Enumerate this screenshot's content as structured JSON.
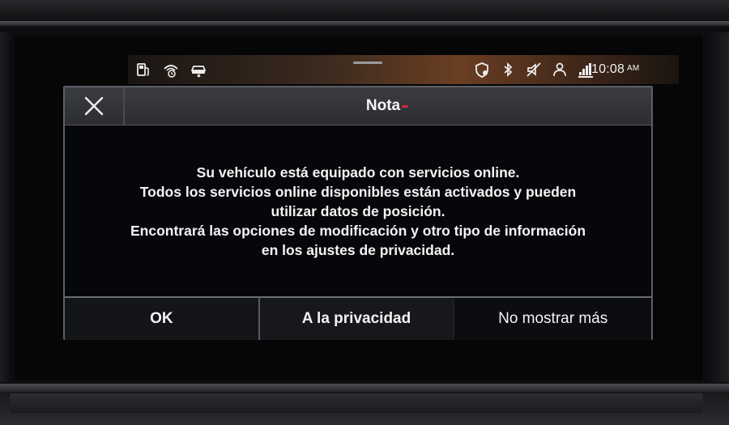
{
  "status_bar": {
    "time": "10:08",
    "ampm": "AM",
    "left_icons": [
      "fuel-icon",
      "connected-services-icon",
      "car-service-icon"
    ],
    "right_icons": [
      "privacy-shield-icon",
      "bluetooth-icon",
      "muted-speaker-icon",
      "profile-icon",
      "signal-lte-icon"
    ]
  },
  "dialog": {
    "title": "Nota",
    "close_icon": "close-icon",
    "message_lines": [
      "Su vehículo está equipado con servicios online.",
      "Todos los servicios online disponibles están activados y pueden",
      "utilizar datos de posición.",
      "Encontrará las opciones de modificación y otro tipo de información",
      "en los ajustes de privacidad."
    ],
    "buttons": {
      "ok": "OK",
      "privacy": "A la privacidad",
      "dont_show": "No mostrar más"
    }
  },
  "colors": {
    "accent_red": "#d4283a",
    "text": "#f4f4f4",
    "dialog_border": "#5c5f66"
  }
}
